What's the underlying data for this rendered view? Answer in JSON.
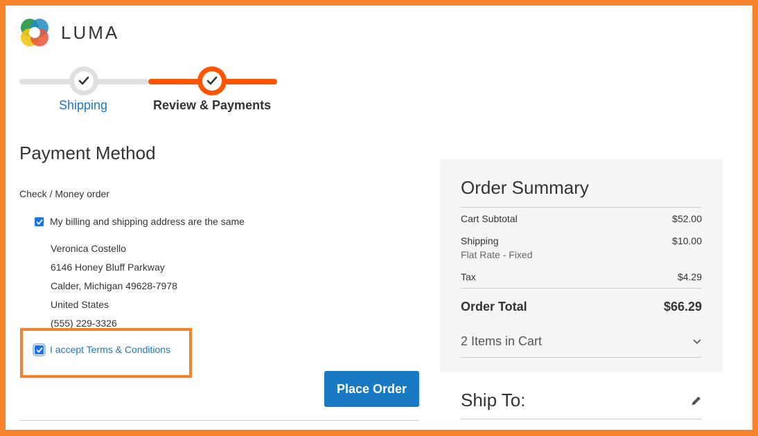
{
  "brand": {
    "name": "LUMA"
  },
  "progress": {
    "steps": [
      {
        "label": "Shipping",
        "state": "complete"
      },
      {
        "label": "Review & Payments",
        "state": "active"
      }
    ]
  },
  "payment": {
    "title": "Payment Method",
    "method_label": "Check / Money order",
    "billing_same_label": "My billing and shipping address are the same",
    "billing_same_checked": true,
    "address": {
      "name": "Veronica Costello",
      "street": "6146 Honey Bluff Parkway",
      "city_line": "Calder, Michigan 49628-7978",
      "country": "United States",
      "phone": "(555) 229-3326"
    },
    "terms_label": "I accept Terms & Conditions",
    "terms_checked": true,
    "place_order_label": "Place Order"
  },
  "summary": {
    "title": "Order Summary",
    "rows": [
      {
        "label": "Cart Subtotal",
        "value": "$52.00"
      },
      {
        "label": "Shipping",
        "value": "$10.00",
        "sub": "Flat Rate - Fixed"
      },
      {
        "label": "Tax",
        "value": "$4.29"
      }
    ],
    "total_label": "Order Total",
    "total_value": "$66.29",
    "items_label": "2 Items in Cart"
  },
  "ship_to": {
    "title": "Ship To:"
  },
  "colors": {
    "accent_orange": "#ff5501",
    "highlight_frame": "#f6822b",
    "primary_blue": "#1979c3"
  },
  "icons": [
    "luma-logo",
    "check-icon",
    "chevron-down-icon",
    "pencil-icon"
  ]
}
